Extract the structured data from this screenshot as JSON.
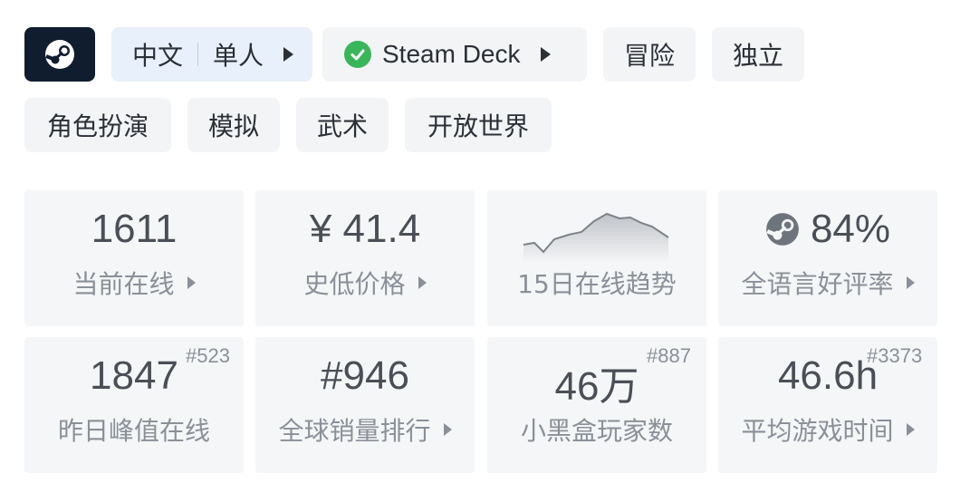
{
  "tags_row1": {
    "steam_icon": "steam-logo-icon",
    "language": "中文",
    "mode": "单人",
    "steam_deck": "Steam Deck",
    "tag_adventure": "冒险",
    "tag_indie": "独立"
  },
  "tags_row2": [
    "角色扮演",
    "模拟",
    "武术",
    "开放世界"
  ],
  "stats": {
    "current_online": {
      "value": "1611",
      "label": "当前在线"
    },
    "lowest_price": {
      "value": "¥ 41.4",
      "label": "史低价格"
    },
    "trend": {
      "label": "15日在线趋势"
    },
    "review": {
      "value": "84%",
      "label": "全语言好评率"
    },
    "yesterday_peak": {
      "value": "1847",
      "rank": "#523",
      "label": "昨日峰值在线"
    },
    "global_rank": {
      "value": "#946",
      "label": "全球销量排行"
    },
    "players": {
      "value": "46万",
      "rank": "#887",
      "label": "小黑盒玩家数"
    },
    "avg_time": {
      "value": "46.6h",
      "rank": "#3373",
      "label": "平均游戏时间"
    }
  },
  "colors": {
    "steam_bg": "#0f1d2f",
    "deck_check": "#3ab65a",
    "lang_bg": "#e8f0fb",
    "card_bg": "#f5f6f7"
  }
}
